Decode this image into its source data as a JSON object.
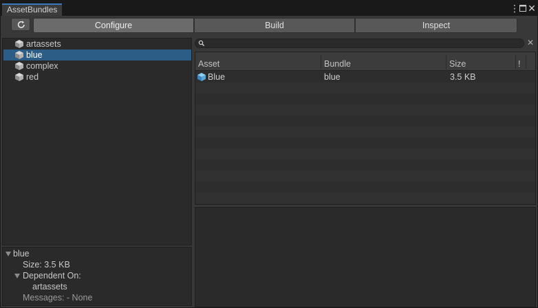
{
  "window": {
    "tab_title": "AssetBundles"
  },
  "toolbar": {
    "modes": [
      {
        "label": "Configure",
        "active": true
      },
      {
        "label": "Build",
        "active": false
      },
      {
        "label": "Inspect",
        "active": false
      }
    ]
  },
  "tree": {
    "items": [
      {
        "label": "artassets",
        "selected": false
      },
      {
        "label": "blue",
        "selected": true
      },
      {
        "label": "complex",
        "selected": false
      },
      {
        "label": "red",
        "selected": false
      }
    ]
  },
  "details": {
    "bundle_name": "blue",
    "size_line": "Size: 3.5 KB",
    "dependent_on_label": "Dependent On:",
    "dependency": "artassets",
    "messages_line": "Messages: - None"
  },
  "search": {
    "value": "",
    "placeholder": ""
  },
  "table": {
    "columns": [
      "Asset",
      "Bundle",
      "Size",
      "!"
    ],
    "rows": [
      {
        "asset": "Blue",
        "bundle": "blue",
        "size": "3.5 KB"
      }
    ]
  },
  "colors": {
    "selection": "#2c5d87",
    "active_tab_accent": "#3a79bb",
    "cube_icon": "#5aa6d8"
  },
  "icons": [
    "refresh-icon",
    "bundle-cube-icon",
    "asset-cube-icon",
    "search-icon",
    "close-icon",
    "menu-icon",
    "maximize-icon",
    "foldout-triangle-icon"
  ]
}
